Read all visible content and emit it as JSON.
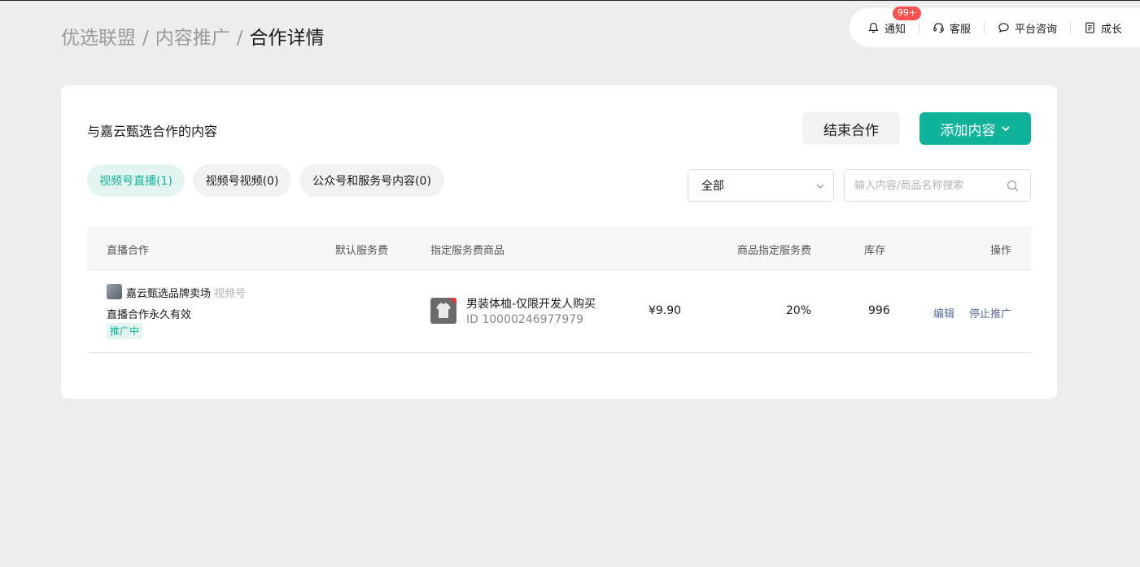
{
  "breadcrumb": {
    "items": [
      "优选联盟",
      "内容推广",
      "合作详情"
    ],
    "separator": "/"
  },
  "topbar": {
    "notify_label": "通知",
    "notify_badge": "99+",
    "service_label": "客服",
    "consult_label": "平台咨询",
    "growth_label": "成长"
  },
  "card": {
    "title": "与嘉云甄选合作的内容",
    "end_button": "结束合作",
    "add_button": "添加内容"
  },
  "tabs": [
    {
      "label": "视频号直播(1)",
      "active": true
    },
    {
      "label": "视频号视频(0)",
      "active": false
    },
    {
      "label": "公众号和服务号内容(0)",
      "active": false
    }
  ],
  "filter": {
    "selected": "全部",
    "search_placeholder": "输入内容/商品名称搜索"
  },
  "table": {
    "headers": {
      "coop": "直播合作",
      "default_fee": "默认服务费",
      "product": "指定服务费商品",
      "product_fee": "商品指定服务费",
      "stock": "库存",
      "action": "操作"
    },
    "rows": [
      {
        "account_name": "嘉云甄选品牌卖场",
        "account_type": "视频号",
        "description": "直播合作永久有效",
        "status": "推广中",
        "product_name": "男装体桖-仅限开发人购买",
        "product_id": "ID 10000246977979",
        "price": "¥9.90",
        "fee_rate": "20%",
        "stock": "996",
        "edit": "编辑",
        "stop": "停止推广"
      }
    ]
  },
  "colors": {
    "accent": "#10b39a",
    "accent_light": "#e3f4f1",
    "badge_red": "#fa5151",
    "link_blue": "#576b95",
    "page_bg": "#ededed"
  },
  "icons": [
    "bell-icon",
    "headset-icon",
    "chat-bubble-icon",
    "document-icon",
    "chevron-down-icon",
    "search-icon"
  ]
}
